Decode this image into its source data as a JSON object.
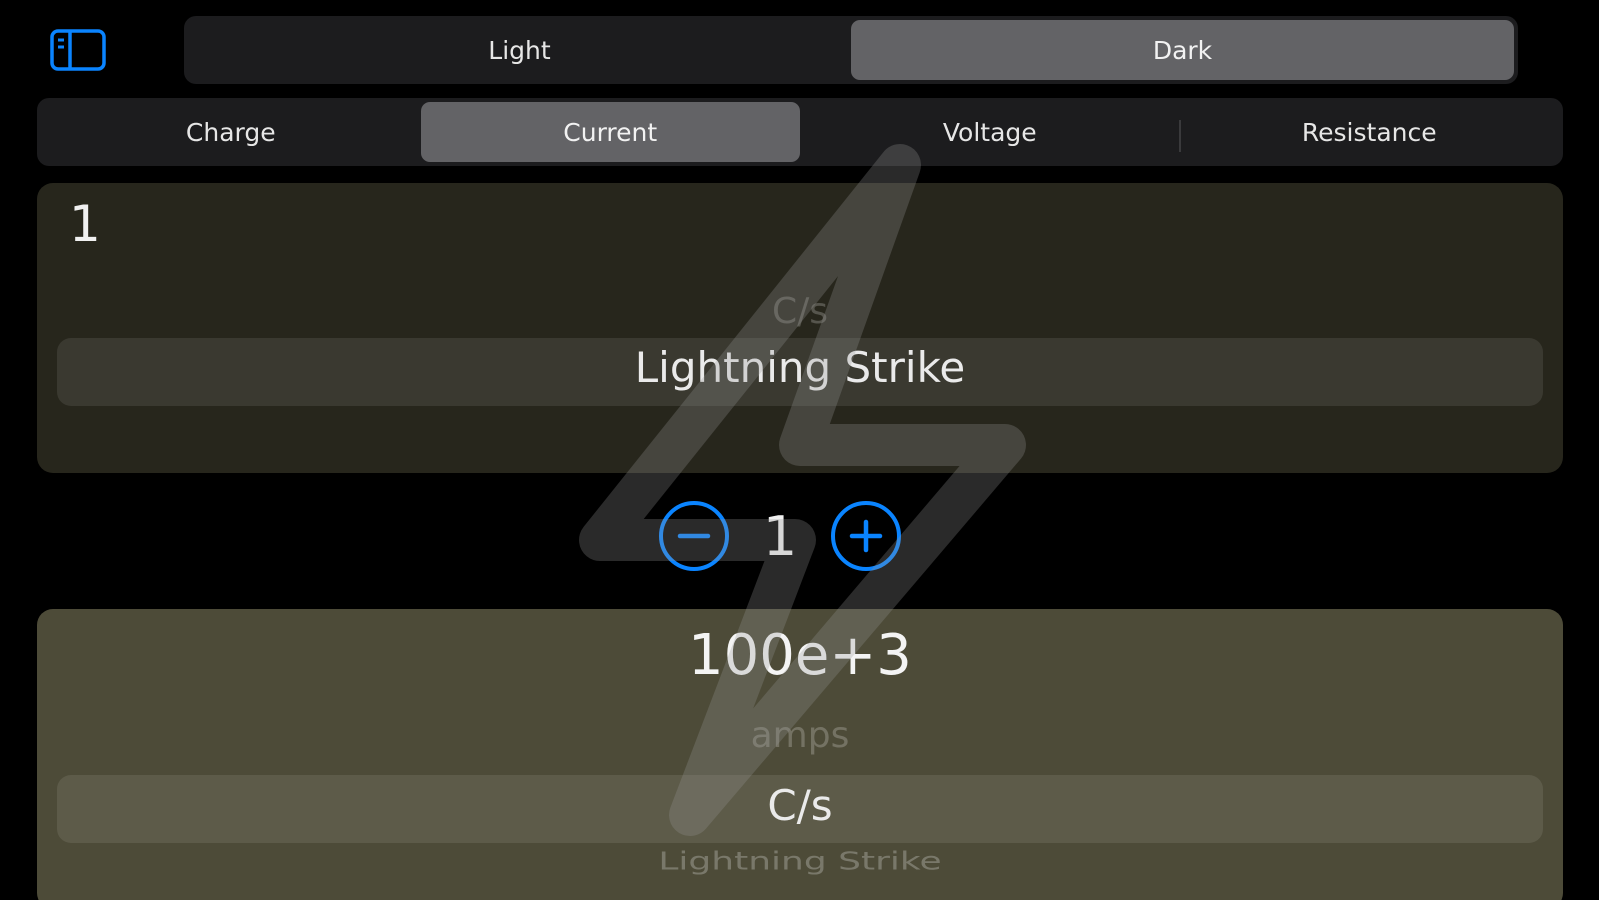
{
  "theme_selector": {
    "options": [
      "Light",
      "Dark"
    ],
    "selected": "Dark"
  },
  "quantity_selector": {
    "options": [
      "Charge",
      "Current",
      "Voltage",
      "Resistance"
    ],
    "selected": "Current"
  },
  "input_panel": {
    "value": "1",
    "picker_above": "C/s",
    "picker_selected": "Lightning Strike"
  },
  "stepper": {
    "value": "1"
  },
  "output_panel": {
    "value": "100e+3",
    "picker_above": "amps",
    "picker_selected": "C/s",
    "picker_below": "Lightning Strike"
  },
  "colors": {
    "accent": "#0a84ff",
    "input_panel_bg": "#27261c",
    "output_panel_bg": "#4d4b38"
  },
  "icons": {
    "sidebar": "sidebar-toggle-icon",
    "minus": "minus-circle-icon",
    "plus": "plus-circle-icon",
    "watermark": "lightning-bolt-icon"
  }
}
